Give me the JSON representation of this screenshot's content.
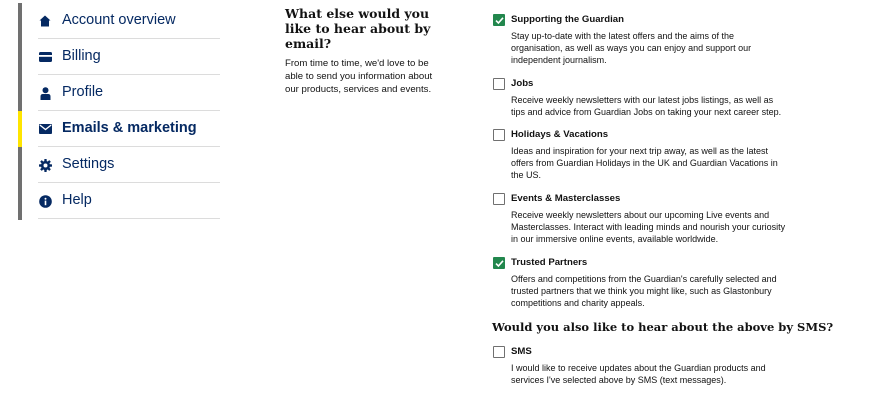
{
  "sidebar": {
    "items": [
      {
        "label": "Account overview",
        "icon": "home-icon"
      },
      {
        "label": "Billing",
        "icon": "credit-card-icon"
      },
      {
        "label": "Profile",
        "icon": "person-icon"
      },
      {
        "label": "Emails & marketing",
        "icon": "envelope-icon",
        "active": true
      },
      {
        "label": "Settings",
        "icon": "gear-icon"
      },
      {
        "label": "Help",
        "icon": "info-icon"
      }
    ],
    "active_accent": "#ffe500"
  },
  "intro": {
    "heading": "What else would you like to hear about by email?",
    "text": "From time to time, we'd love to be able to send you information about our products, services and events."
  },
  "options": [
    {
      "title": "Supporting the Guardian",
      "checked": true,
      "description": "Stay up-to-date with the latest offers and the aims of the organisation, as well as ways you can enjoy and support our independent journalism."
    },
    {
      "title": "Jobs",
      "checked": false,
      "description": "Receive weekly newsletters with our latest jobs listings, as well as tips and advice from Guardian Jobs on taking your next career step."
    },
    {
      "title": "Holidays & Vacations",
      "checked": false,
      "description": "Ideas and inspiration for your next trip away, as well as the latest offers from Guardian Holidays in the UK and Guardian Vacations in the US."
    },
    {
      "title": "Events & Masterclasses",
      "checked": false,
      "description": "Receive weekly newsletters about our upcoming Live events and Masterclasses. Interact with leading minds and nourish your curiosity in our immersive online events, available worldwide."
    },
    {
      "title": "Trusted Partners",
      "checked": true,
      "description": "Offers and competitions from the Guardian's carefully selected and trusted partners that we think you might like, such as Glastonbury competitions and charity appeals."
    }
  ],
  "sms": {
    "heading": "Would you also like to hear about the above by SMS?",
    "option": {
      "title": "SMS",
      "checked": false,
      "description": "I would like to receive updates about the Guardian products and services I've selected above by SMS (text messages)."
    }
  },
  "colors": {
    "brand_blue": "#052962",
    "check_green": "#22874d"
  }
}
